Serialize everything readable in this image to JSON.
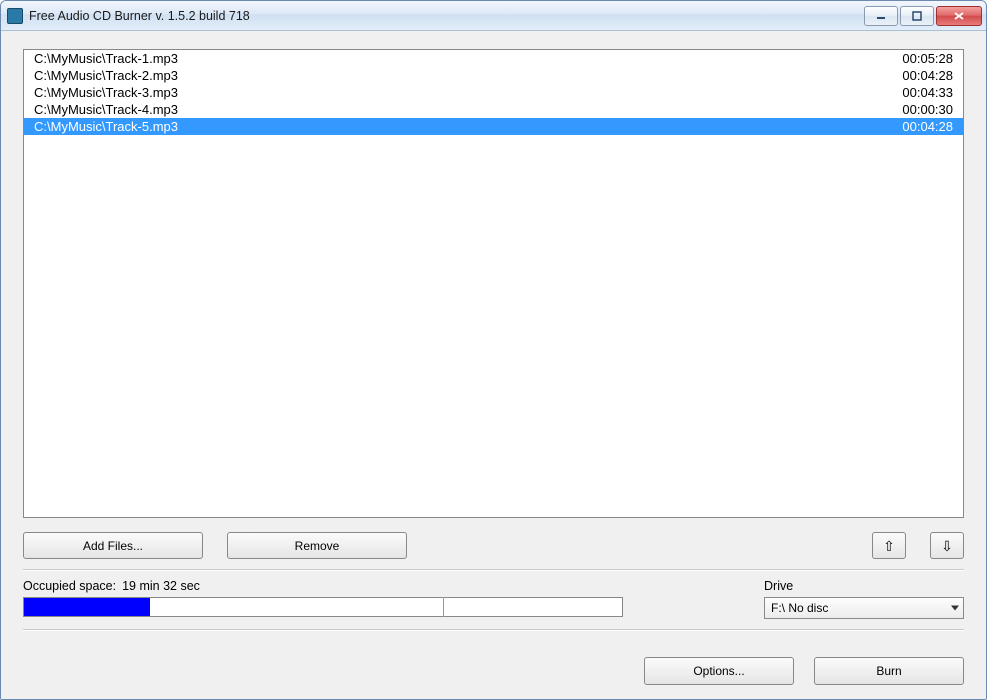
{
  "window": {
    "title": "Free Audio CD Burner  v. 1.5.2 build 718"
  },
  "tracks": [
    {
      "path": "C:\\MyMusic\\Track-1.mp3",
      "duration": "00:05:28",
      "selected": false
    },
    {
      "path": "C:\\MyMusic\\Track-2.mp3",
      "duration": "00:04:28",
      "selected": false
    },
    {
      "path": "C:\\MyMusic\\Track-3.mp3",
      "duration": "00:04:33",
      "selected": false
    },
    {
      "path": "C:\\MyMusic\\Track-4.mp3",
      "duration": "00:00:30",
      "selected": false
    },
    {
      "path": "C:\\MyMusic\\Track-5.mp3",
      "duration": "00:04:28",
      "selected": true
    }
  ],
  "toolbar": {
    "add_files": "Add Files...",
    "remove": "Remove"
  },
  "occupied": {
    "label": "Occupied space:",
    "value": "19 min 32 sec",
    "percent": 21
  },
  "drive": {
    "label": "Drive",
    "selected": "F:\\ No disc"
  },
  "bottom": {
    "options": "Options...",
    "burn": "Burn"
  }
}
